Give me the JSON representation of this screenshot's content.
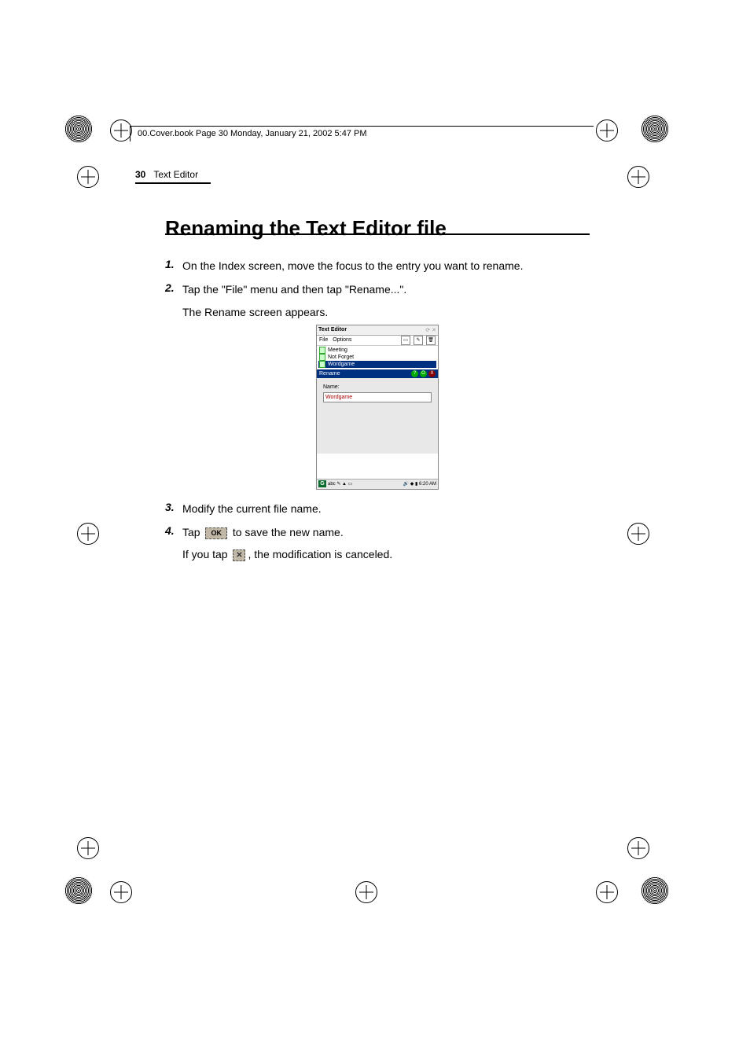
{
  "book_info_line": "00.Cover.book  Page 30  Monday, January 21, 2002  5:47 PM",
  "page_number": "30",
  "section_name": "Text Editor",
  "heading": "Renaming the Text Editor file",
  "steps": {
    "s1": {
      "num": "1.",
      "text": "On the Index screen, move the focus to the entry you want to rename."
    },
    "s2": {
      "num": "2.",
      "text": "Tap the \"File\" menu and then tap \"Rename...\"."
    },
    "s2_sub": "The Rename screen appears.",
    "s3": {
      "num": "3.",
      "text": "Modify the current file name."
    },
    "s4": {
      "num": "4.",
      "pre": "Tap ",
      "post": " to save the new name."
    },
    "s4_ok_label": "OK",
    "s4_sub_pre": "If you tap ",
    "s4_sub_post": ", the modification is canceled.",
    "x_glyph": "✕"
  },
  "figure": {
    "app_title": "Text Editor",
    "menu_file": "File",
    "menu_options": "Options",
    "list": [
      "Meeting",
      "Not Forget",
      "Wordgame"
    ],
    "rename_title": "Rename",
    "name_label": "Name:",
    "input_value": "Wordgame",
    "help_glyph": "?",
    "ok_glyph": "O",
    "x_glyph": "X",
    "taskbar_g": "G",
    "taskbar_time": "6:20 AM"
  }
}
